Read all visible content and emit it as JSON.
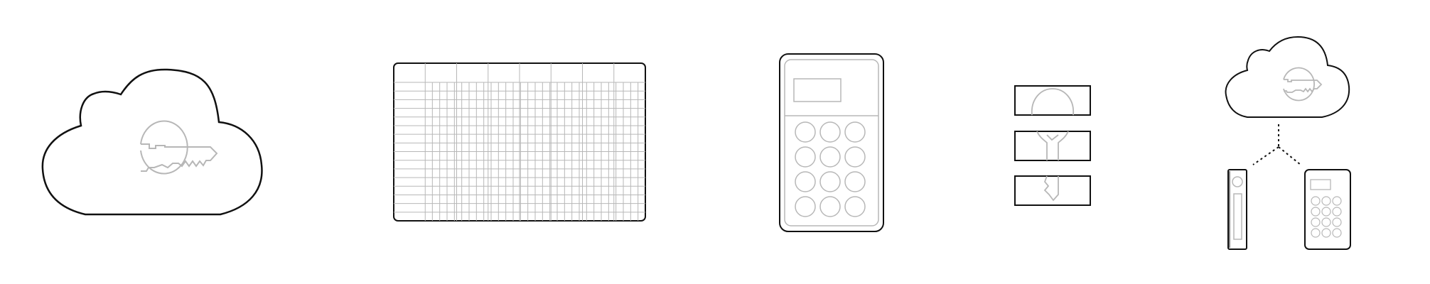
{
  "colors": {
    "background": "#ffffff",
    "outline": "#111111",
    "detail": "#b7b7b7"
  },
  "illustrations": [
    {
      "icon": "cloud-key-icon"
    },
    {
      "icon": "spreadsheet-grid-icon"
    },
    {
      "icon": "keypad-device-icon"
    },
    {
      "icon": "split-key-shards-icon"
    },
    {
      "icon": "cloud-backup-devices-icon"
    }
  ]
}
